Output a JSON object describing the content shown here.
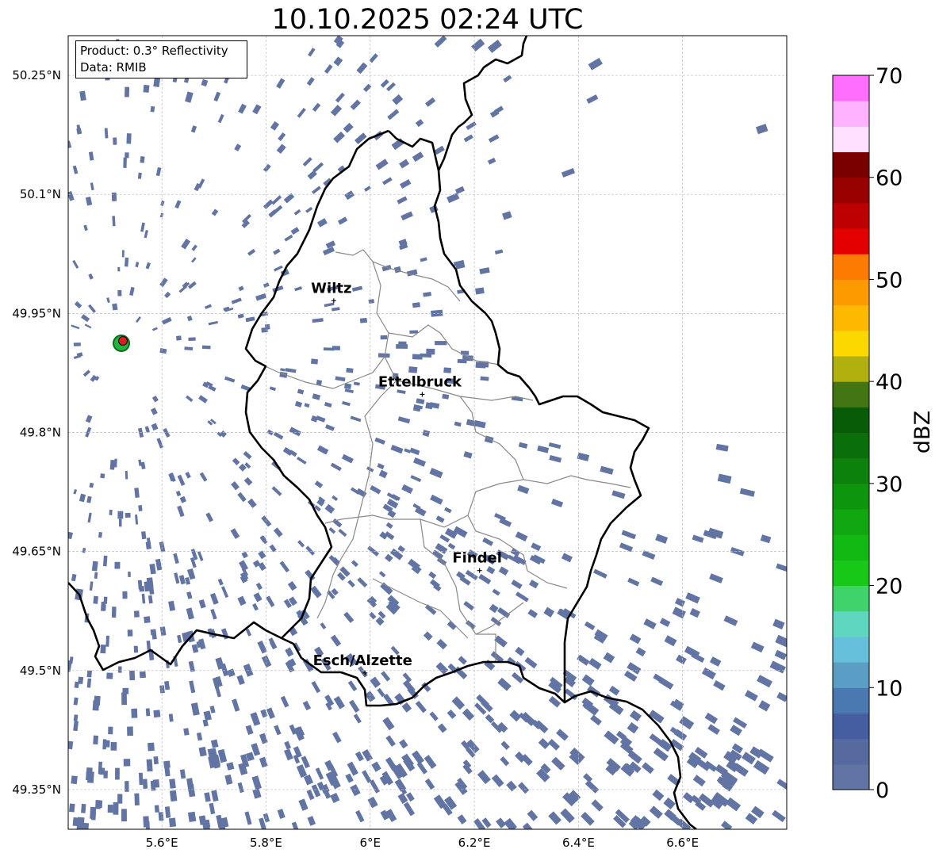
{
  "title": "10.10.2025 02:24 UTC",
  "info_box": {
    "product": "Product: 0.3° Reflectivity",
    "data": "Data: RMIB"
  },
  "map": {
    "lon_range": [
      5.42,
      6.8
    ],
    "lat_range": [
      49.3,
      50.3
    ],
    "lat_ticks": [
      {
        "value": 50.25,
        "label": "50.25°N"
      },
      {
        "value": 50.1,
        "label": "50.1°N"
      },
      {
        "value": 49.95,
        "label": "49.95°N"
      },
      {
        "value": 49.8,
        "label": "49.8°N"
      },
      {
        "value": 49.65,
        "label": "49.65°N"
      },
      {
        "value": 49.5,
        "label": "49.5°N"
      },
      {
        "value": 49.35,
        "label": "49.35°N"
      }
    ],
    "lon_ticks": [
      {
        "value": 5.6,
        "label": "5.6°E"
      },
      {
        "value": 5.8,
        "label": "5.8°E"
      },
      {
        "value": 6.0,
        "label": "6°E"
      },
      {
        "value": 6.2,
        "label": "6.2°E"
      },
      {
        "value": 6.4,
        "label": "6.4°E"
      },
      {
        "value": 6.6,
        "label": "6.6°E"
      }
    ],
    "gridlines": true,
    "radar_site": {
      "lon": 5.505,
      "lat": 49.914
    },
    "cities": [
      {
        "name": "Wiltz",
        "lon": 5.93,
        "lat": 49.966
      },
      {
        "name": "Ettelbruck",
        "lon": 6.1,
        "lat": 49.848
      },
      {
        "name": "Findel",
        "lon": 6.21,
        "lat": 49.626
      },
      {
        "name": "Esch/Alzette",
        "lon": 5.99,
        "lat": 49.497
      }
    ],
    "echo_color": "#6174a4"
  },
  "colorbar": {
    "label": "dBZ",
    "min": 0,
    "max": 70,
    "step": 2.5,
    "ticks": [
      "0",
      "10",
      "20",
      "30",
      "40",
      "50",
      "60",
      "70"
    ],
    "colors": [
      "#6174a4",
      "#566aa0",
      "#445ea1",
      "#4a78b0",
      "#5a9ec5",
      "#66c0dc",
      "#5fd7c0",
      "#40d36b",
      "#18c818",
      "#13b913",
      "#10a710",
      "#0e950e",
      "#0c810c",
      "#0a6e0a",
      "#085c08",
      "#437613",
      "#b0b10f",
      "#fdd700",
      "#fdb800",
      "#fd9a00",
      "#fd7b00",
      "#e50000",
      "#bd0000",
      "#990000",
      "#7a0000",
      "#ffe0ff",
      "#ffb2ff",
      "#ff6eff",
      "#e83ee8"
    ]
  }
}
